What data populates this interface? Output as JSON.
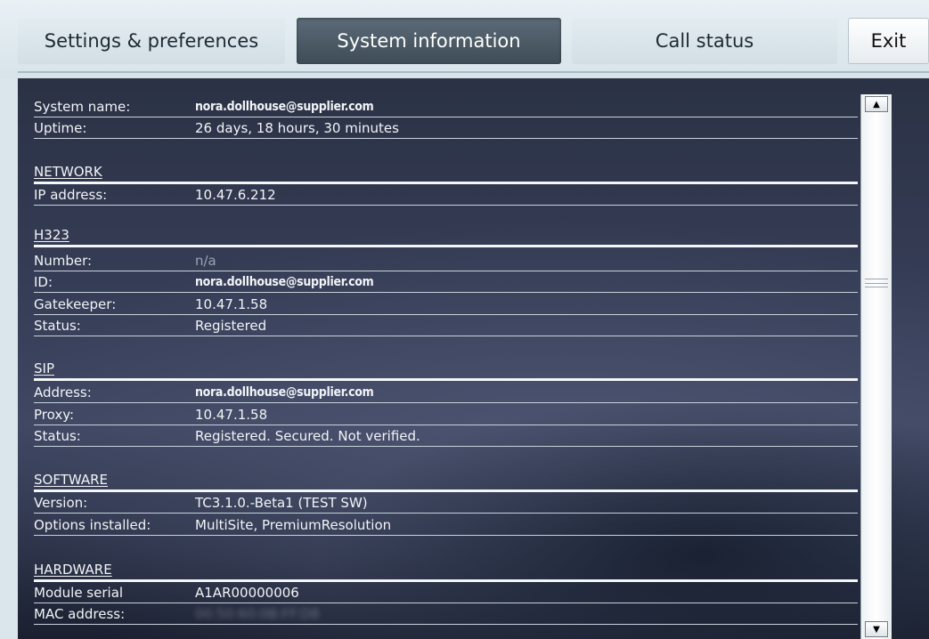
{
  "tabs": {
    "settings": "Settings & preferences",
    "system_info": "System information",
    "call_status": "Call status",
    "exit": "Exit"
  },
  "system": {
    "name_label": "System name:",
    "name_value": "nora.dollhouse@supplier.com",
    "uptime_label": "Uptime:",
    "uptime_value": "26 days, 18 hours, 30 minutes"
  },
  "network": {
    "header": "NETWORK",
    "ip_label": "IP address:",
    "ip_value": "10.47.6.212"
  },
  "h323": {
    "header": "H323",
    "number_label": "Number:",
    "number_value": "n/a",
    "id_label": "ID:",
    "id_value": "nora.dollhouse@supplier.com",
    "gatekeeper_label": "Gatekeeper:",
    "gatekeeper_value": "10.47.1.58",
    "status_label": "Status:",
    "status_value": "Registered"
  },
  "sip": {
    "header": "SIP",
    "address_label": "Address:",
    "address_value": "nora.dollhouse@supplier.com",
    "proxy_label": "Proxy:",
    "proxy_value": "10.47.1.58",
    "status_label": "Status:",
    "status_value": "Registered. Secured. Not verified."
  },
  "software": {
    "header": "SOFTWARE",
    "version_label": "Version:",
    "version_value": "TC3.1.0.-Beta1 (TEST SW)",
    "options_label": "Options installed:",
    "options_value": "MultiSite, PremiumResolution"
  },
  "hardware": {
    "header": "HARDWARE",
    "serial_label": "Module serial",
    "serial_value": "A1AR00000006",
    "mac_label": "MAC address:",
    "mac_value": "00:50:60:0B:FF:D8"
  },
  "scrollbar": {
    "up_glyph": "▲",
    "down_glyph": "▼"
  }
}
